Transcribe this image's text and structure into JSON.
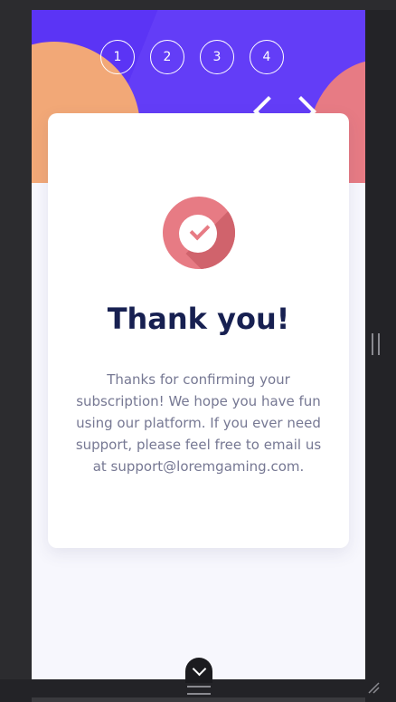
{
  "steps": [
    {
      "label": "1"
    },
    {
      "label": "2"
    },
    {
      "label": "3"
    },
    {
      "label": "4"
    }
  ],
  "card": {
    "title": "Thank you!",
    "message": "Thanks for confirming your subscription! We hope you have fun using our platform. If you ever need support, please feel free to email us at support@loremgaming.com."
  },
  "colors": {
    "hero_purple": "#5b34f5",
    "accent_orange": "#f2a877",
    "accent_pink": "#e77b84",
    "title_navy": "#172051",
    "body_text": "#767893"
  },
  "icons": {
    "success": "check-circle-icon",
    "back": "chevron-left-icon",
    "toggle": "chevron-down-icon"
  }
}
